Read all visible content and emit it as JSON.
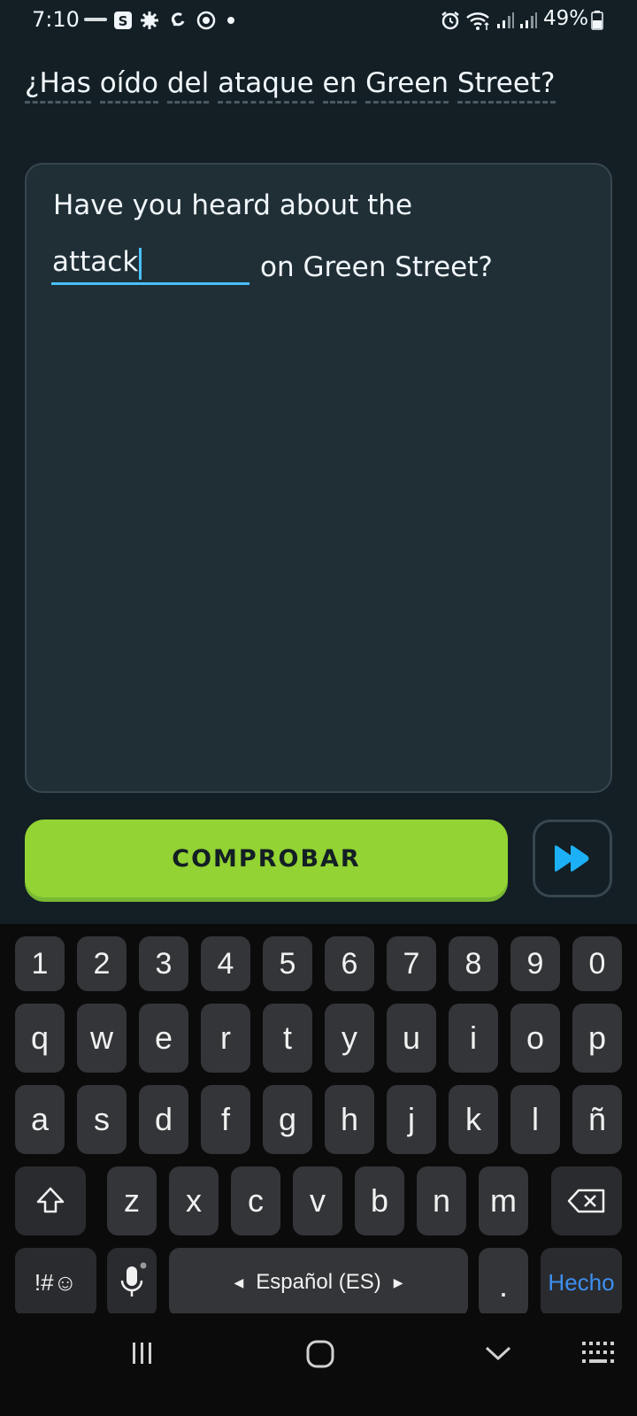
{
  "status_bar": {
    "time": "7:10",
    "battery": "49%",
    "icons": [
      "coinbase-icon",
      "s-app-icon",
      "gear-app-icon",
      "sync-app-icon",
      "target-app-icon",
      "dot-icon",
      "alarm-icon",
      "wifi-icon",
      "signal-icon",
      "signal-icon-2",
      "battery-icon"
    ]
  },
  "prompt": {
    "words": [
      "¿Has",
      "oído",
      "del",
      "ataque",
      "en",
      "Green",
      "Street?"
    ]
  },
  "answer": {
    "line1": "Have you heard about the",
    "input_value": "attack",
    "line2": "on Green Street?"
  },
  "actions": {
    "check_label": "COMPROBAR",
    "skip_icon": "fast-forward-icon"
  },
  "keyboard": {
    "row_numbers": [
      "1",
      "2",
      "3",
      "4",
      "5",
      "6",
      "7",
      "8",
      "9",
      "0"
    ],
    "row1": [
      "q",
      "w",
      "e",
      "r",
      "t",
      "y",
      "u",
      "i",
      "o",
      "p"
    ],
    "row2": [
      "a",
      "s",
      "d",
      "f",
      "g",
      "h",
      "j",
      "k",
      "l",
      "ñ"
    ],
    "row3": [
      "z",
      "x",
      "c",
      "v",
      "b",
      "n",
      "m"
    ],
    "symbols_label": "!#☺",
    "space_label": "Español (ES)",
    "period_label": ".",
    "done_label": "Hecho",
    "done_color": "#3d8ff0"
  },
  "colors": {
    "background": "#131f24",
    "card": "#202f36",
    "accent_blue": "#49c0f8",
    "button_green": "#93d333"
  }
}
